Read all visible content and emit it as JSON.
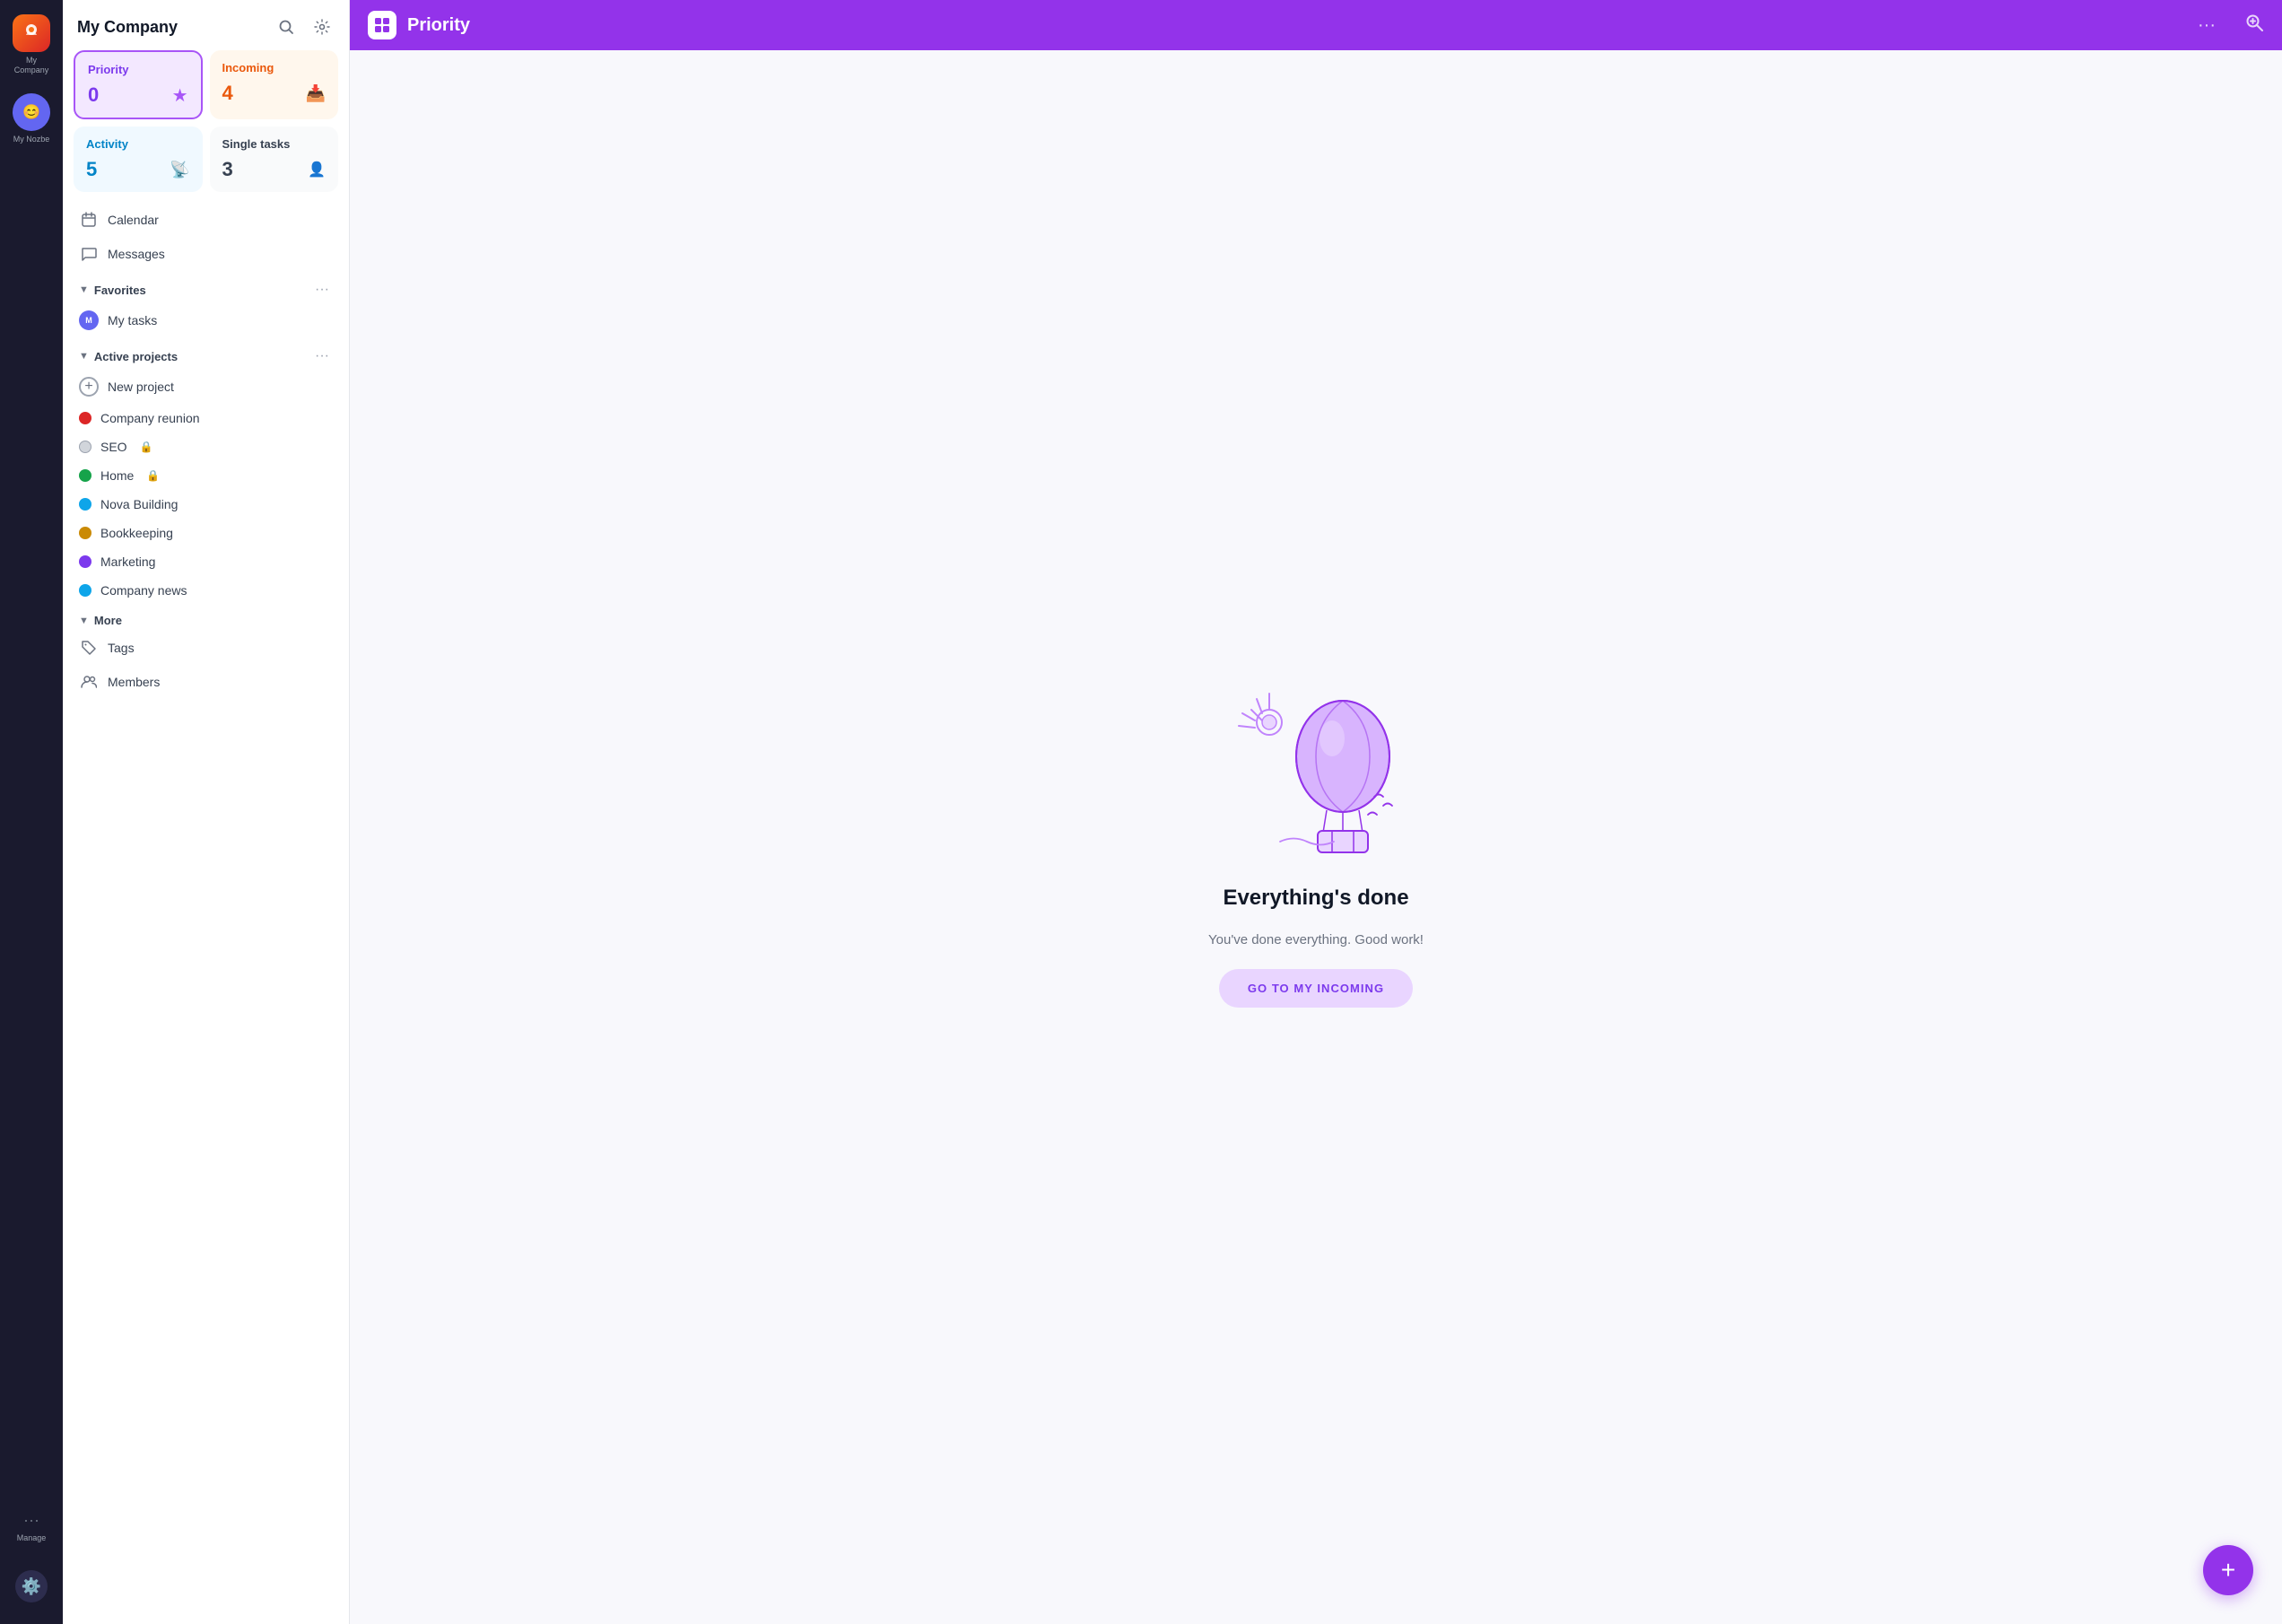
{
  "iconBar": {
    "companyLabel": "My Company",
    "userLabel": "My Nozbe",
    "manageLabel": "Manage",
    "manageIcon": "···",
    "bottomIcon": "⚙"
  },
  "sidebar": {
    "title": "My Company",
    "searchIcon": "🔍",
    "settingsIcon": "⚙",
    "cards": [
      {
        "id": "priority",
        "label": "Priority",
        "count": "0",
        "icon": "★",
        "type": "priority"
      },
      {
        "id": "incoming",
        "label": "Incoming",
        "count": "4",
        "icon": "📥",
        "type": "incoming"
      },
      {
        "id": "activity",
        "label": "Activity",
        "count": "5",
        "icon": "📡",
        "type": "activity"
      },
      {
        "id": "single",
        "label": "Single tasks",
        "count": "3",
        "icon": "👤",
        "type": "single"
      }
    ],
    "navItems": [
      {
        "id": "calendar",
        "label": "Calendar",
        "icon": "📅"
      },
      {
        "id": "messages",
        "label": "Messages",
        "icon": "💬"
      }
    ],
    "favorites": {
      "label": "Favorites",
      "moreIcon": "···",
      "items": [
        {
          "id": "my-tasks",
          "label": "My tasks",
          "hasAvatar": true
        }
      ]
    },
    "activeProjects": {
      "label": "Active projects",
      "moreIcon": "···",
      "items": [
        {
          "id": "new-project",
          "label": "New project",
          "dotColor": null,
          "isNew": true
        },
        {
          "id": "company-reunion",
          "label": "Company reunion",
          "dotColor": "#dc2626"
        },
        {
          "id": "seo",
          "label": "SEO",
          "dotColor": "#d1d5db",
          "hasLock": true
        },
        {
          "id": "home",
          "label": "Home",
          "dotColor": "#16a34a",
          "hasLock": true
        },
        {
          "id": "nova-building",
          "label": "Nova Building",
          "dotColor": "#0ea5e9"
        },
        {
          "id": "bookkeeping",
          "label": "Bookkeeping",
          "dotColor": "#ca8a04"
        },
        {
          "id": "marketing",
          "label": "Marketing",
          "dotColor": "#7c3aed"
        },
        {
          "id": "company-news",
          "label": "Company news",
          "dotColor": "#0ea5e9"
        }
      ]
    },
    "more": {
      "label": "More",
      "items": [
        {
          "id": "tags",
          "label": "Tags",
          "icon": "🏷"
        },
        {
          "id": "members",
          "label": "Members",
          "icon": "👥"
        }
      ]
    }
  },
  "topBar": {
    "iconBg": "#7c3aed",
    "iconChar": "□",
    "title": "Priority",
    "dotsLabel": "···",
    "tabs": [
      {
        "id": "priority",
        "label": "Priority",
        "active": true
      }
    ],
    "searchIcon": "🔍"
  },
  "emptyState": {
    "title": "Everything's done",
    "subtitle": "You've done everything. Good work!",
    "buttonLabel": "GO TO MY INCOMING"
  },
  "fab": {
    "icon": "+"
  }
}
